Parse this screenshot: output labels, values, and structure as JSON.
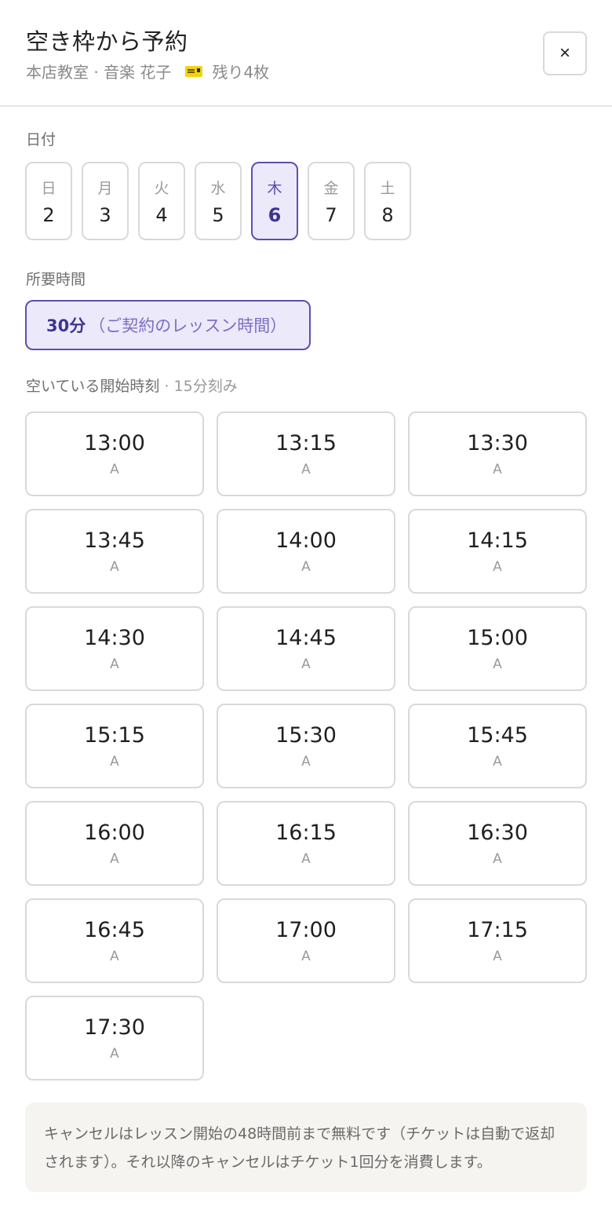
{
  "header": {
    "title": "空き枠から予約",
    "subtitle": "本店教室 · 音楽 花子",
    "ticket_icon": "ticket-icon",
    "tickets_remaining": "残り4枚",
    "close_label": "×"
  },
  "date_section": {
    "label": "日付",
    "dates": [
      {
        "dow": "日",
        "day": "2"
      },
      {
        "dow": "月",
        "day": "3"
      },
      {
        "dow": "火",
        "day": "4"
      },
      {
        "dow": "水",
        "day": "5"
      },
      {
        "dow": "木",
        "day": "6",
        "selected": true
      },
      {
        "dow": "金",
        "day": "7"
      },
      {
        "dow": "土",
        "day": "8"
      }
    ]
  },
  "duration_section": {
    "label": "所要時間",
    "duration": "30分",
    "duration_note": "（ご契約のレッスン時間）"
  },
  "slots_section": {
    "label": "空いている開始時刻",
    "sub_label": " · 15分刻み",
    "slots": [
      {
        "time": "13:00",
        "room": "A"
      },
      {
        "time": "13:15",
        "room": "A"
      },
      {
        "time": "13:30",
        "room": "A"
      },
      {
        "time": "13:45",
        "room": "A"
      },
      {
        "time": "14:00",
        "room": "A"
      },
      {
        "time": "14:15",
        "room": "A"
      },
      {
        "time": "14:30",
        "room": "A"
      },
      {
        "time": "14:45",
        "room": "A"
      },
      {
        "time": "15:00",
        "room": "A"
      },
      {
        "time": "15:15",
        "room": "A"
      },
      {
        "time": "15:30",
        "room": "A"
      },
      {
        "time": "15:45",
        "room": "A"
      },
      {
        "time": "16:00",
        "room": "A"
      },
      {
        "time": "16:15",
        "room": "A"
      },
      {
        "time": "16:30",
        "room": "A"
      },
      {
        "time": "16:45",
        "room": "A"
      },
      {
        "time": "17:00",
        "room": "A"
      },
      {
        "time": "17:15",
        "room": "A"
      },
      {
        "time": "17:30",
        "room": "A"
      }
    ]
  },
  "notice": {
    "text": "キャンセルはレッスン開始の48時間前まで無料です（チケットは自動で返却されます）。それ以降のキャンセルはチケット1回分を消費します。"
  }
}
